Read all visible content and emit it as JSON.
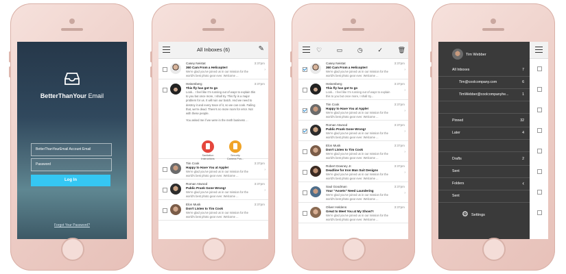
{
  "login": {
    "brand_bold": "BetterThanYour",
    "brand_light": " Email",
    "account_placeholder": "BetterThanYourEmail Account Email",
    "password_placeholder": "Password",
    "login_label": "Log In",
    "forgot_label": "Forgot Your Password?"
  },
  "inbox": {
    "title": "All Inboxes (6)",
    "messages": [
      {
        "name": "Casey Neistat",
        "time": "3:37pm",
        "subject": "360 Cam From a Helicopter!",
        "preview": "We're glad you've joined us in our mission for the world's best photo gear ever. Welcome ..."
      },
      {
        "name": "Heisenberg",
        "time": "3:37pm",
        "subject": "This fly has got to go",
        "body1": "Look... I feel like I'm running out of ways to explain this to you but once more, I shall try. This fly is a major problem for us. It will ruin our batch. And we need to destroy it and every trace of it, so we can cook. Failing that, we're dead. There's no more room for error. Not with these people.",
        "body2": "You asked me if we were in the meth business ...",
        "att1": "Sanitation Instructions",
        "att2": "Security Camera Pos..."
      },
      {
        "name": "Tim Cook",
        "time": "3:37pm",
        "subject": "Happy to Have You at Apple!",
        "preview": "We're glad you've joined us in our mission for the world's best photo gear ever. Welcome ..."
      },
      {
        "name": "Roman Atwood",
        "time": "3:37pm",
        "subject": "Public Prank Gone Wrong!",
        "preview": "We're glad you've joined us in our mission for the world's best photo gear ever. Welcome ..."
      },
      {
        "name": "Elon Musk",
        "time": "3:37pm",
        "subject": "Don't Listen to Tim Cook",
        "preview": "We're glad you've joined us in our mission for the world's best photo gear ever. Welcome ..."
      }
    ]
  },
  "select": {
    "toolbar": [
      "heart-icon",
      "folder-icon",
      "clock-icon",
      "check-icon",
      "trash-icon"
    ],
    "messages": [
      {
        "name": "Casey Neistat",
        "time": "3:37pm",
        "subject": "360 Cam From a Helicopter!",
        "preview": "We're glad you've joined us in our mission for the world's best photo gear ever. Welcome ...",
        "checked": true
      },
      {
        "name": "Heisenberg",
        "time": "3:37pm",
        "subject": "This fly has got to go",
        "preview": "Look... I feel like I'm running out of ways to explain this to you but once more, I shall try...",
        "checked": false
      },
      {
        "name": "Tim Cook",
        "time": "3:37pm",
        "subject": "Happy to Have You at Apple!",
        "preview": "We're glad you've joined us in our mission for the world's best photo gear ever. Welcome ...",
        "checked": true
      },
      {
        "name": "Roman Atwood",
        "time": "3:37pm",
        "subject": "Public Prank Gone Wrong!",
        "preview": "We're glad you've joined us in our mission for the world's best photo gear ever. Welcome ...",
        "checked": true
      },
      {
        "name": "Elon Musk",
        "time": "3:37pm",
        "subject": "Don't Listen to Tim Cook",
        "preview": "We're glad you've joined us in our mission for the world's best photo gear ever. Welcome ...",
        "checked": false
      },
      {
        "name": "Robert Downey Jr.",
        "time": "3:37pm",
        "subject": "Deadline for Iron Man Suit Designs",
        "preview": "We're glad you've joined us in our mission for the world's best photo gear ever. Welcome ...",
        "checked": false
      },
      {
        "name": "Saul Goodman",
        "time": "3:37pm",
        "subject": "Your \"Assets\" Need Laundering",
        "preview": "We're glad you've joined us in our mission for the world's best photo gear ever. Welcome ...",
        "checked": false
      },
      {
        "name": "Oliver Heldens",
        "time": "3:37pm",
        "subject": "Great to Meet You at My Show?!",
        "preview": "We're glad you've joined us in our mission for the world's best photo gear ever. Welcome ...",
        "checked": false
      }
    ]
  },
  "menu": {
    "user": "Tim Webber",
    "all_inboxes": "All Inboxes",
    "all_inboxes_count": "7",
    "account1": "Tim@coolcompany.com",
    "account1_count": "6",
    "account2": "TimWebber@coolcompanyhe...",
    "account2_count": "1",
    "pinned": "Pinned",
    "pinned_count": "32",
    "later": "Later",
    "later_count": "4",
    "drafts": "Drafts",
    "drafts_count": "2",
    "sent": "Sent",
    "folders": "Folders",
    "folders_chevron": "‹",
    "sent2": "Sent",
    "settings": "Settings"
  }
}
